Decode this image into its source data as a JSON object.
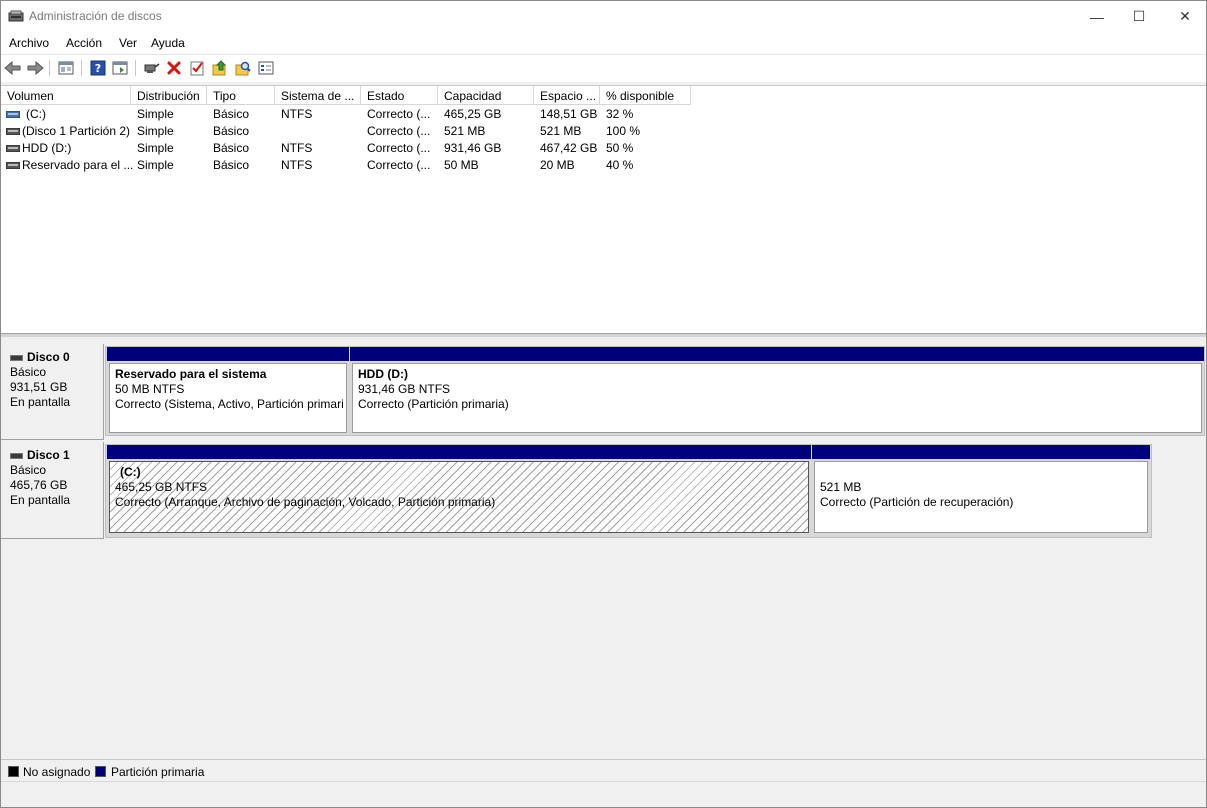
{
  "window": {
    "title": "Administración de discos",
    "minimize": "—",
    "maximize": "☐",
    "close": "✕"
  },
  "menu": [
    "Archivo",
    "Acción",
    "Ver",
    "Ayuda"
  ],
  "toolbar": [
    "back-icon",
    "forward-icon",
    "show-hide-console-tree-icon",
    "help-icon",
    "properties-pane-icon",
    "connect-drive-icon",
    "delete-icon",
    "check-icon",
    "up-folder-icon",
    "find-icon",
    "properties-icon"
  ],
  "columns": [
    "Volumen",
    "Distribución",
    "Tipo",
    "Sistema de ...",
    "Estado",
    "Capacidad",
    "Espacio ...",
    "% disponible"
  ],
  "volumes": [
    {
      "vol": "(C:)",
      "layout": "Simple",
      "type": "Básico",
      "fs": "NTFS",
      "status": "Correcto (...",
      "capacity": "465,25 GB",
      "free": "148,51 GB",
      "pct": "32 %"
    },
    {
      "vol": "(Disco 1 Partición 2)",
      "layout": "Simple",
      "type": "Básico",
      "fs": "",
      "status": "Correcto (...",
      "capacity": "521 MB",
      "free": "521 MB",
      "pct": "100 %"
    },
    {
      "vol": "HDD (D:)",
      "layout": "Simple",
      "type": "Básico",
      "fs": "NTFS",
      "status": "Correcto (...",
      "capacity": "931,46 GB",
      "free": "467,42 GB",
      "pct": "50 %"
    },
    {
      "vol": "Reservado para el ...",
      "layout": "Simple",
      "type": "Básico",
      "fs": "NTFS",
      "status": "Correcto (...",
      "capacity": "50 MB",
      "free": "20 MB",
      "pct": "40 %"
    }
  ],
  "disks": [
    {
      "name": "Disco 0",
      "type": "Básico",
      "size": "931,51 GB",
      "state": "En pantalla",
      "partitions": [
        {
          "title": "Reservado para el sistema",
          "size": "50 MB NTFS",
          "status": "Correcto (Sistema, Activo, Partición primari"
        },
        {
          "title": "HDD  (D:)",
          "size": "931,46 GB NTFS",
          "status": "Correcto (Partición primaria)"
        }
      ]
    },
    {
      "name": "Disco 1",
      "type": "Básico",
      "size": "465,76 GB",
      "state": "En pantalla",
      "partitions": [
        {
          "title": "(C:)",
          "size": "465,25 GB NTFS",
          "status": "Correcto (Arranque, Archivo de paginación, Volcado, Partición primaria)"
        },
        {
          "title": "",
          "size": "521 MB",
          "status": "Correcto (Partición de recuperación)"
        }
      ]
    }
  ],
  "legend": [
    {
      "label": "No asignado",
      "color": "#000000"
    },
    {
      "label": "Partición primaria",
      "color": "#00007f"
    }
  ],
  "colors": {
    "primary_partition": "#00007f",
    "unallocated": "#000000"
  }
}
